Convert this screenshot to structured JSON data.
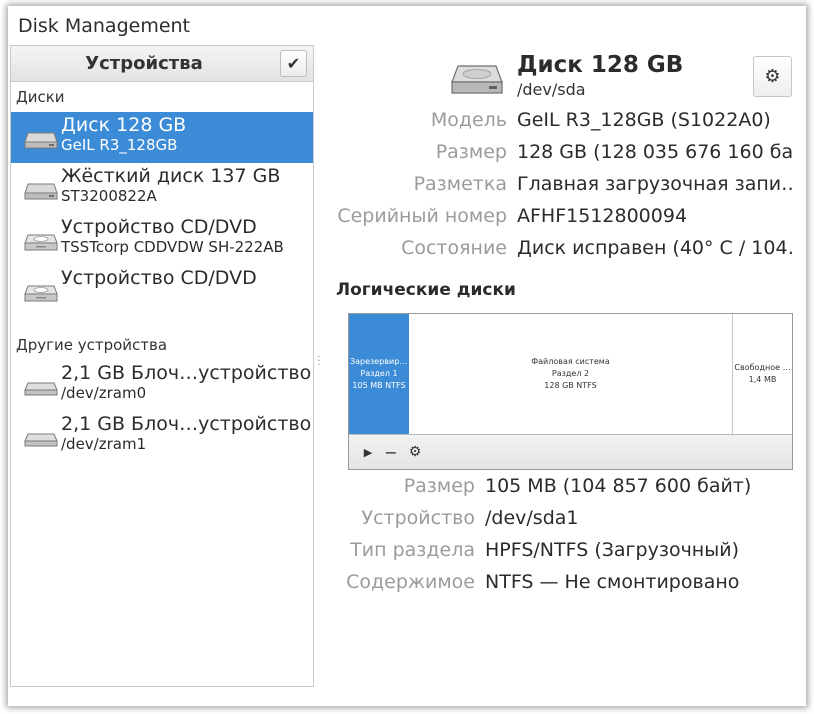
{
  "app": {
    "title": "Disk Management"
  },
  "sidebar": {
    "header": "Устройства",
    "check_icon": "✔",
    "sections": {
      "disks_label": "Диски",
      "other_label": "Другие устройства"
    },
    "disks": [
      {
        "name": "Диск 128 GB",
        "sub": "GeIL R3_128GB",
        "icon": "hdd-icon",
        "selected": true
      },
      {
        "name": "Жёсткий диск 137 GB",
        "sub": "ST3200822A",
        "icon": "hdd-icon",
        "selected": false
      },
      {
        "name": "Устройство CD/DVD",
        "sub": "TSSTcorp CDDVDW SH-222AB",
        "icon": "optical-drive-icon",
        "selected": false
      },
      {
        "name": "Устройство CD/DVD",
        "sub": "",
        "icon": "optical-drive-icon",
        "selected": false
      }
    ],
    "other": [
      {
        "name": "2,1 GB Блоч…устройство",
        "sub": "/dev/zram0",
        "icon": "block-device-icon"
      },
      {
        "name": "2,1 GB Блоч…устройство",
        "sub": "/dev/zram1",
        "icon": "block-device-icon"
      }
    ]
  },
  "disk": {
    "title": "Диск 128 GB",
    "path": "/dev/sda",
    "gear_icon": "⚙",
    "properties": [
      {
        "key": "Модель",
        "value": "GeIL R3_128GB (S1022A0)"
      },
      {
        "key": "Размер",
        "value": "128 GB (128 035 676 160 ба…"
      },
      {
        "key": "Разметка",
        "value": "Главная загрузочная запи…"
      },
      {
        "key": "Серийный номер",
        "value": "AFHF1512800094"
      },
      {
        "key": "Состояние",
        "value": "Диск исправен (40° C / 104…"
      }
    ]
  },
  "logical": {
    "title": "Логические диски",
    "partitions": [
      {
        "lines": [
          "Зарезервиро…",
          "Раздел 1",
          "105 MB NTFS"
        ],
        "selected": true
      },
      {
        "lines": [
          "Файловая система",
          "Раздел 2",
          "128 GB NTFS"
        ],
        "selected": false
      },
      {
        "lines": [
          "Свободное …",
          "1,4 MB"
        ],
        "selected": false
      }
    ],
    "toolbar": {
      "play_icon": "▶",
      "minus_icon": "−",
      "gears_icon": "⚙"
    },
    "properties": [
      {
        "key": "Размер",
        "value": "105 MB (104 857 600 байт)"
      },
      {
        "key": "Устройство",
        "value": "/dev/sda1"
      },
      {
        "key": "Тип раздела",
        "value": "HPFS/NTFS (Загрузочный)"
      },
      {
        "key": "Содержимое",
        "value": "NTFS — Не смонтировано"
      }
    ]
  }
}
